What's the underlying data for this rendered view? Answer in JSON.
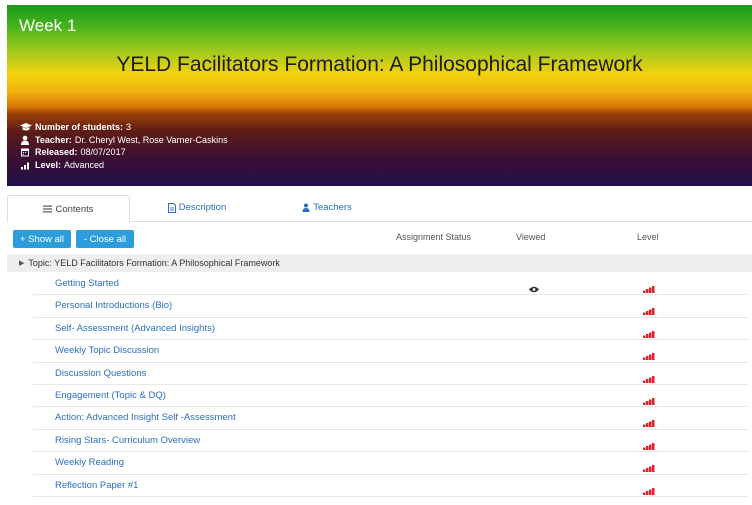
{
  "header": {
    "week": "Week 1",
    "title": "YELD Facilitators Formation: A Philosophical Framework",
    "meta": [
      {
        "key": "Number of students:",
        "value": "3",
        "icon": "graduation-cap-icon"
      },
      {
        "key": "Teacher:",
        "value": "Dr. Cheryl West, Rose Varner-Caskins",
        "icon": "user-icon"
      },
      {
        "key": "Released:",
        "value": "08/07/2017",
        "icon": "calendar-icon"
      },
      {
        "key": "Level:",
        "value": "Advanced",
        "icon": "signal-bars-icon"
      }
    ]
  },
  "tabs": [
    {
      "label": "Contents",
      "icon": "list-icon"
    },
    {
      "label": "Description",
      "icon": "document-icon"
    },
    {
      "label": "Teachers",
      "icon": "user-icon"
    }
  ],
  "buttons": {
    "show_all": "+ Show all",
    "close_all": "- Close all"
  },
  "columns": {
    "assignment_status": "Assignment Status",
    "viewed": "Viewed",
    "level": "Level"
  },
  "topic": "Topic: YELD Facilitators Formation: A Philosophical Framework",
  "items": [
    {
      "label": "Getting Started",
      "viewed": true
    },
    {
      "label": "Personal Introductions (Bio)",
      "viewed": false
    },
    {
      "label": "Self- Assessment (Advanced Insights)",
      "viewed": false
    },
    {
      "label": "Weekly Topic Discussion",
      "viewed": false
    },
    {
      "label": "Discussion Questions",
      "viewed": false
    },
    {
      "label": "Engagement (Topic & DQ)",
      "viewed": false
    },
    {
      "label": "Action: Advanced Insight Self -Assessment",
      "viewed": false
    },
    {
      "label": "Rising Stars- Curriculum Overview",
      "viewed": false
    },
    {
      "label": "Weekly Reading",
      "viewed": false
    },
    {
      "label": "Reflection Paper #1",
      "viewed": false
    }
  ],
  "colors": {
    "link": "#2a6fbe",
    "button": "#2b9ddb",
    "level": "#e0202a"
  }
}
